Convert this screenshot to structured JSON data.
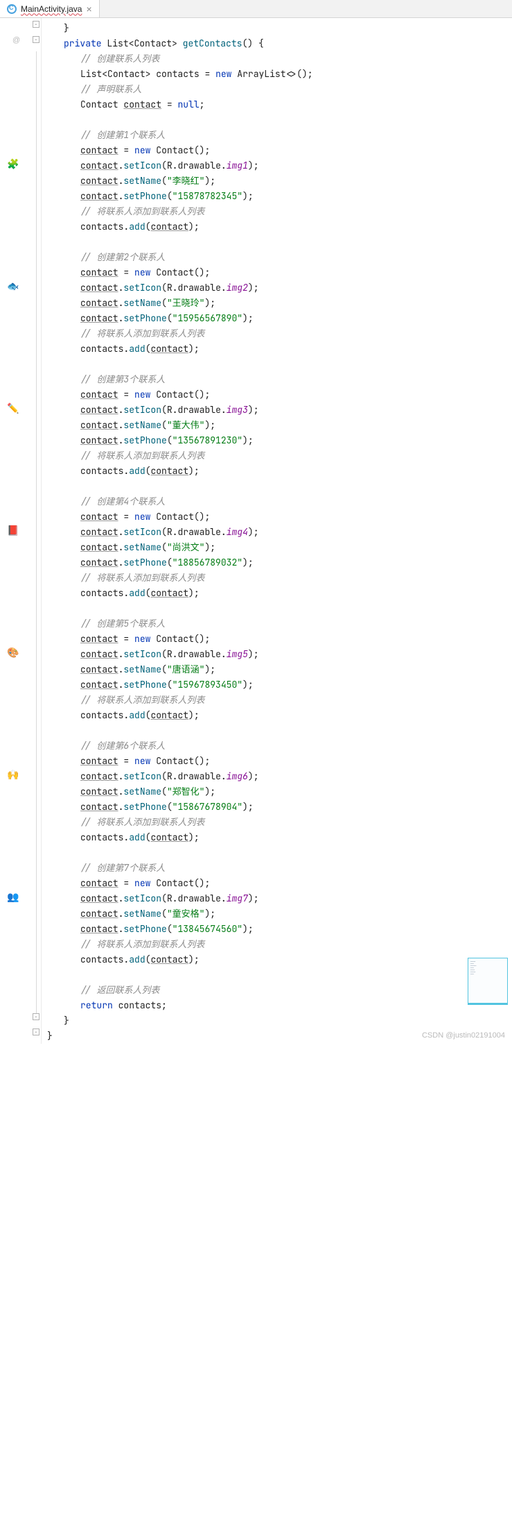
{
  "tab": {
    "filename": "MainActivity.java",
    "close": "×"
  },
  "gutter": {
    "override": "@"
  },
  "folds": {
    "minus": "−"
  },
  "sig": {
    "private": "private",
    "list": "List",
    "contact": "Contact",
    "method": "getContacts",
    "parens": "() {"
  },
  "kw": {
    "new": "new",
    "null": "null",
    "return": "return"
  },
  "types": {
    "list": "List",
    "contact": "Contact",
    "arraylist": "ArrayList"
  },
  "vars": {
    "contacts": "contacts",
    "contact": "contact"
  },
  "calls": {
    "setIcon": "setIcon",
    "setName": "setName",
    "setPhone": "setPhone",
    "add": "add",
    "r": "R",
    "drawable": "drawable"
  },
  "comments": {
    "createList": "// 创建联系人列表",
    "declare": "// 声明联系人",
    "addToList": "// 将联系人添加到联系人列表",
    "returnList": "// 返回联系人列表"
  },
  "blocks": [
    {
      "header": "// 创建第1个联系人",
      "img": "img1",
      "name": "\"李晓红\"",
      "phone": "\"15878782345\""
    },
    {
      "header": "// 创建第2个联系人",
      "img": "img2",
      "name": "\"王晓玲\"",
      "phone": "\"15956567890\""
    },
    {
      "header": "// 创建第3个联系人",
      "img": "img3",
      "name": "\"董大伟\"",
      "phone": "\"13567891230\""
    },
    {
      "header": "// 创建第4个联系人",
      "img": "img4",
      "name": "\"尚洪文\"",
      "phone": "\"18856789032\""
    },
    {
      "header": "// 创建第5个联系人",
      "img": "img5",
      "name": "\"唐语涵\"",
      "phone": "\"15967893450\""
    },
    {
      "header": "// 创建第6个联系人",
      "img": "img6",
      "name": "\"郑智化\"",
      "phone": "\"15867678904\""
    },
    {
      "header": "// 创建第7个联系人",
      "img": "img7",
      "name": "\"童安格\"",
      "phone": "\"13845674560\""
    }
  ],
  "gutterEmojis": [
    "🧩",
    "🐟",
    "✏️",
    "📕",
    "🎨",
    "🙌",
    "👥"
  ],
  "watermark": "CSDN @justin02191004"
}
